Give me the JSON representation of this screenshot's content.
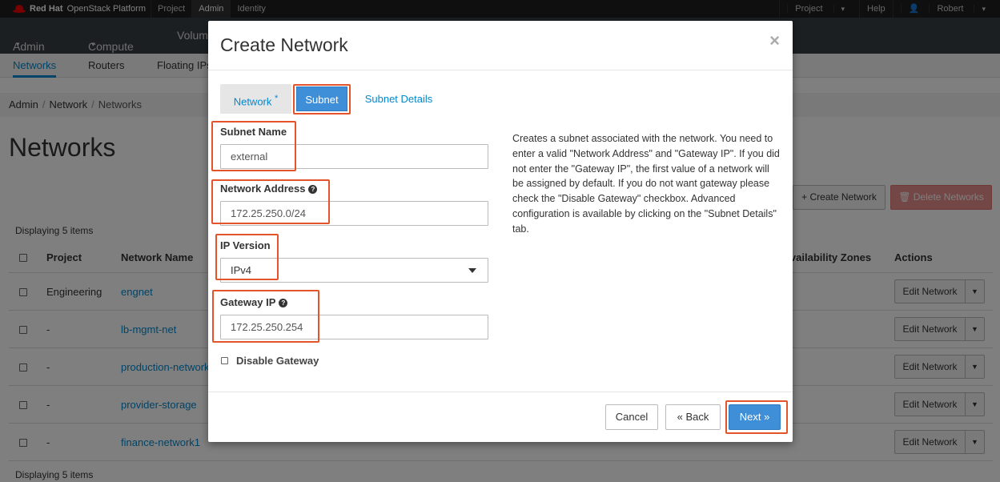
{
  "topbar": {
    "brand_strong": "Red Hat",
    "brand_rest": "OpenStack Platform",
    "nav": [
      "Project",
      "Admin",
      "Identity"
    ],
    "right": {
      "project": "Project",
      "help": "Help",
      "user": "Robert"
    }
  },
  "navbar2": {
    "admin": "Admin",
    "compute": "Compute",
    "volumes": "Volumes"
  },
  "tabs": {
    "networks": "Networks",
    "routers": "Routers",
    "floating_ips": "Floating IPs"
  },
  "breadcrumb": {
    "admin": "Admin",
    "network": "Network",
    "networks": "Networks"
  },
  "page": {
    "title": "Networks",
    "displaying_top": "Displaying 5 items",
    "displaying_bottom": "Displaying 5 items",
    "create_network": "Create Network",
    "delete_networks": "Delete Networks"
  },
  "table": {
    "headers": {
      "project": "Project",
      "network_name": "Network Name",
      "availability_zones": "Availability Zones",
      "actions": "Actions"
    },
    "rows": [
      {
        "project": "Engineering",
        "name": "engnet",
        "action": "Edit Network"
      },
      {
        "project": "-",
        "name": "lb-mgmt-net",
        "action": "Edit Network"
      },
      {
        "project": "-",
        "name": "production-network",
        "action": "Edit Network"
      },
      {
        "project": "-",
        "name": "provider-storage",
        "action": "Edit Network"
      },
      {
        "project": "-",
        "name": "finance-network1",
        "action": "Edit Network"
      }
    ]
  },
  "modal": {
    "title": "Create Network",
    "close": "×",
    "tabs": {
      "network": "Network",
      "required_mark": "*",
      "subnet": "Subnet",
      "subnet_details": "Subnet Details"
    },
    "fields": {
      "subnet_name_label": "Subnet Name",
      "subnet_name_value": "external",
      "network_address_label": "Network Address",
      "network_address_value": "172.25.250.0/24",
      "ip_version_label": "IP Version",
      "ip_version_value": "IPv4",
      "gateway_ip_label": "Gateway IP",
      "gateway_ip_value": "172.25.250.254",
      "disable_gateway_label": "Disable Gateway"
    },
    "help_text": "Creates a subnet associated with the network. You need to enter a valid \"Network Address\" and \"Gateway IP\". If you did not enter the \"Gateway IP\", the first value of a network will be assigned by default. If you do not want gateway please check the \"Disable Gateway\" checkbox. Advanced configuration is available by clicking on the \"Subnet Details\" tab.",
    "buttons": {
      "cancel": "Cancel",
      "back": "Back",
      "next": "Next"
    }
  }
}
